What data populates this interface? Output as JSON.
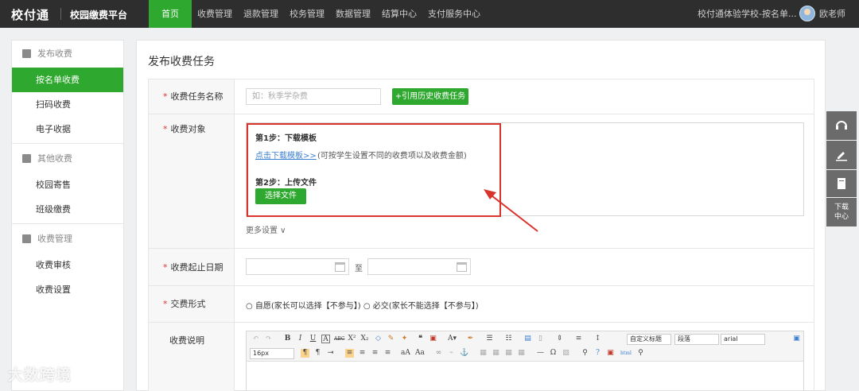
{
  "topbar": {
    "logo": "校付通",
    "platform": "校园缴费平台",
    "nav": [
      "首页",
      "收费管理",
      "退款管理",
      "校务管理",
      "数据管理",
      "结算中心",
      "支付服务中心"
    ],
    "school": "校付通体验学校-按名单...",
    "username": "欧老师"
  },
  "sidebar": {
    "group1": "发布收费",
    "items1": [
      "按名单收费",
      "扫码收费",
      "电子收据"
    ],
    "group2": "其他收费",
    "items2": [
      "校园寄售",
      "班级缴费"
    ],
    "group3": "收费管理",
    "items3": [
      "收费审核",
      "收费设置"
    ]
  },
  "main": {
    "title": "发布收费任务",
    "task_name_label": "收费任务名称",
    "task_name_placeholder": "如：秋季学杂费",
    "history_button": "+引用历史收费任务",
    "target_label": "收费对象",
    "step1_title": "第1步：下载模板",
    "download_link": "点击下载模板>>",
    "download_note": "(可按学生设置不同的收费项以及收费金额)",
    "step2_title": "第2步：上传文件",
    "choose_file_button": "选择文件",
    "more_settings": "更多设置 ∨",
    "date_label": "收费起止日期",
    "date_to": "至",
    "pay_form_label": "交费形式",
    "pay_form_options": "○ 自愿(家长可以选择【不参与】) ○ 必交(家长不能选择【不参与】)",
    "desc_label": "收费说明"
  },
  "editor": {
    "custom_heading": "自定义标题",
    "paragraph": "段落",
    "font": "arial",
    "font_size": "16px"
  },
  "float_tools": {
    "download_center": "下载\n中心"
  },
  "watermark": "大数跨境",
  "colors": {
    "accent": "#2ea82e",
    "highlight": "#d9342b",
    "topbar": "#2e2e2e"
  }
}
